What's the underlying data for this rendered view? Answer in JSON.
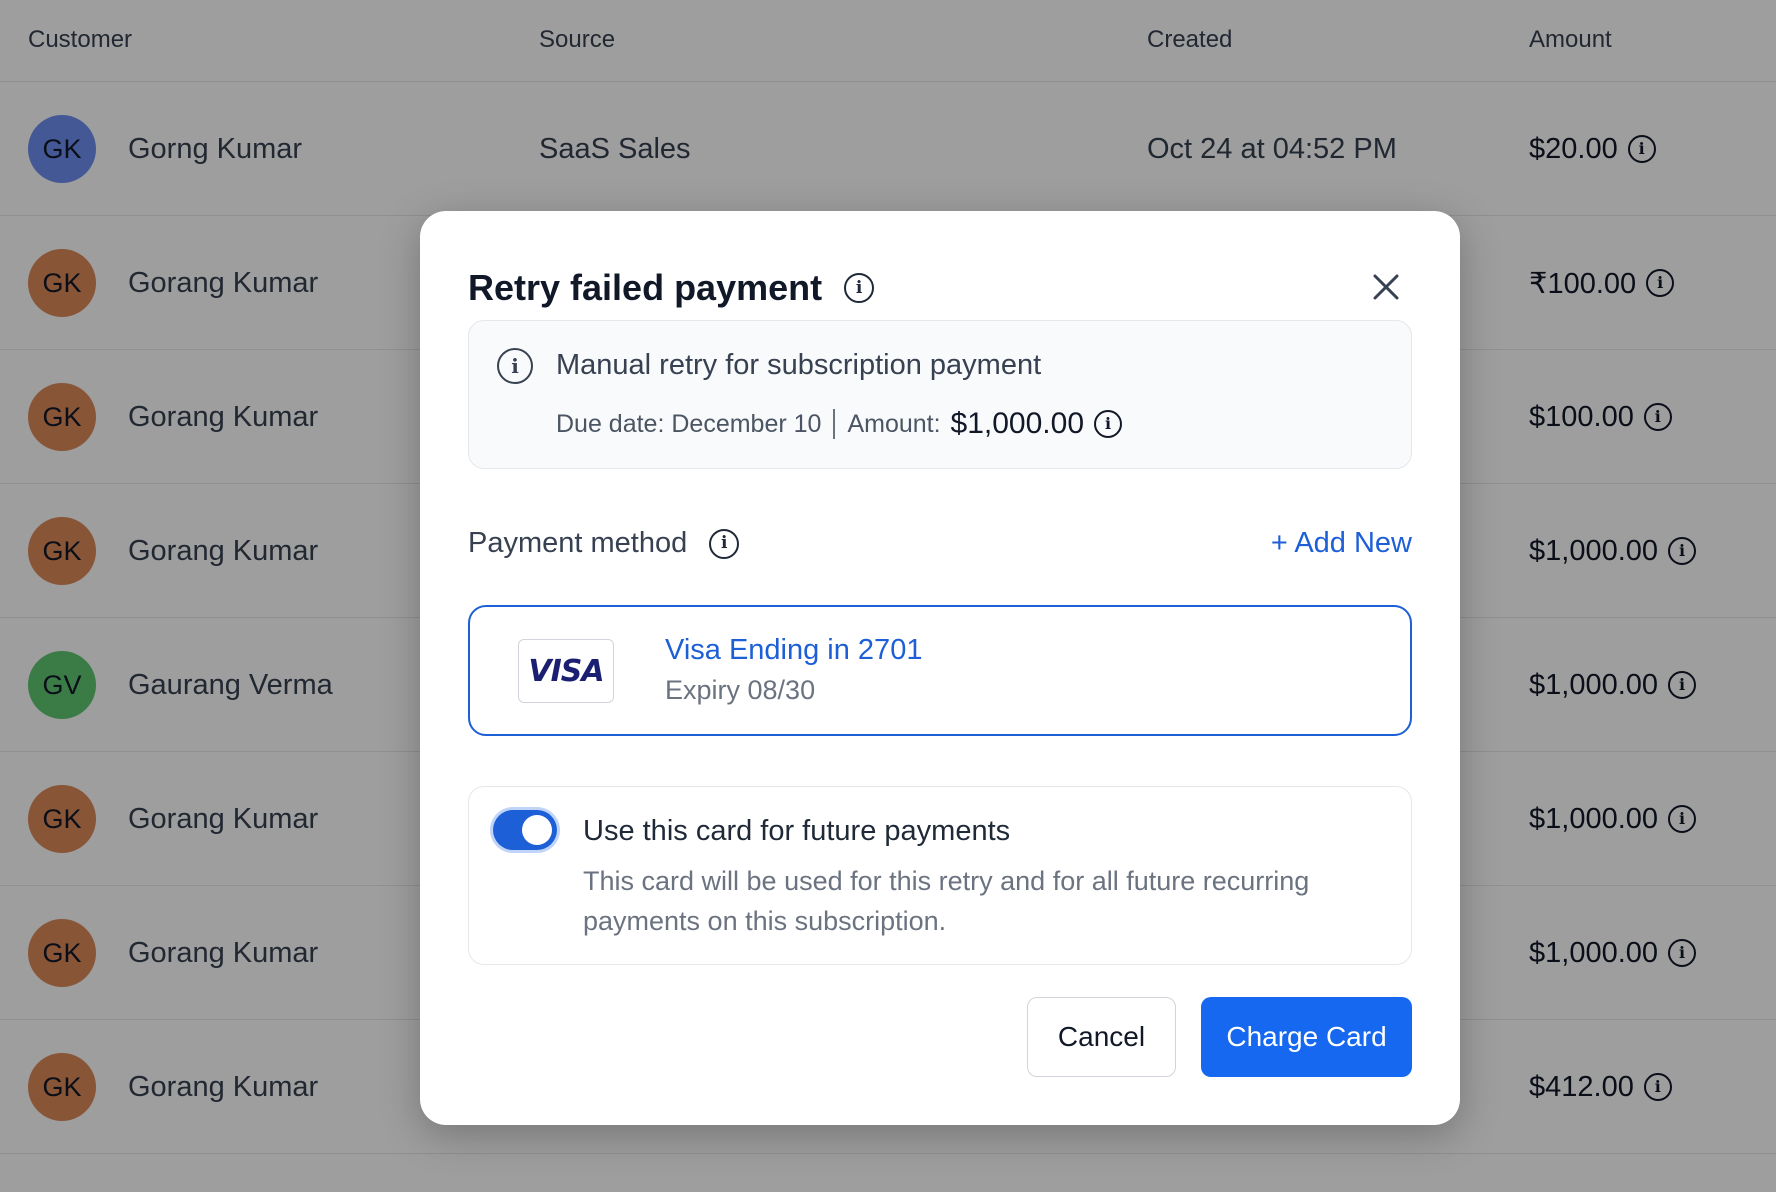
{
  "table": {
    "headers": {
      "customer": "Customer",
      "source": "Source",
      "created": "Created",
      "amount": "Amount"
    },
    "rows": [
      {
        "initials": "GK",
        "name": "Gorng Kumar",
        "source": "SaaS Sales",
        "created": "Oct 24 at 04:52 PM",
        "amount": "$20.00",
        "avatar_color": "#6d8ef0"
      },
      {
        "initials": "GK",
        "name": "Gorang Kumar",
        "source": "",
        "created": "",
        "amount": "₹100.00",
        "avatar_color": "#dc8a5a"
      },
      {
        "initials": "GK",
        "name": "Gorang Kumar",
        "source": "",
        "created": "",
        "amount": "$100.00",
        "avatar_color": "#dc8a5a"
      },
      {
        "initials": "GK",
        "name": "Gorang Kumar",
        "source": "",
        "created": "",
        "amount": "$1,000.00",
        "avatar_color": "#dc8a5a"
      },
      {
        "initials": "GV",
        "name": "Gaurang Verma",
        "source": "",
        "created": "",
        "amount": "$1,000.00",
        "avatar_color": "#5fc772"
      },
      {
        "initials": "GK",
        "name": "Gorang Kumar",
        "source": "",
        "created": "",
        "amount": "$1,000.00",
        "avatar_color": "#dc8a5a"
      },
      {
        "initials": "GK",
        "name": "Gorang Kumar",
        "source": "",
        "created": "",
        "amount": "$1,000.00",
        "avatar_color": "#dc8a5a"
      },
      {
        "initials": "GK",
        "name": "Gorang Kumar",
        "source": "",
        "created": "",
        "amount": "$412.00",
        "avatar_color": "#dc8a5a"
      }
    ]
  },
  "modal": {
    "title": "Retry failed payment",
    "notice": {
      "title": "Manual retry for subscription payment",
      "due_date": "Due date: December 10",
      "amount_label": "Amount:",
      "amount_value": "$1,000.00"
    },
    "payment_method": {
      "label": "Payment method",
      "add_new": "+ Add New",
      "card": {
        "brand": "VISA",
        "title": "Visa Ending in 2701",
        "expiry": "Expiry 08/30"
      }
    },
    "future": {
      "enabled": true,
      "title": "Use this card for future payments",
      "description": "This card will be used for this retry and for all future recurring payments on this subscription."
    },
    "actions": {
      "cancel": "Cancel",
      "charge": "Charge Card"
    }
  },
  "colors": {
    "primary": "#1668f0",
    "link": "#1d5fd6",
    "overlay": "rgba(0,0,0,0.38)"
  },
  "icons": {
    "info": "info-circle-icon",
    "close": "close-icon"
  }
}
